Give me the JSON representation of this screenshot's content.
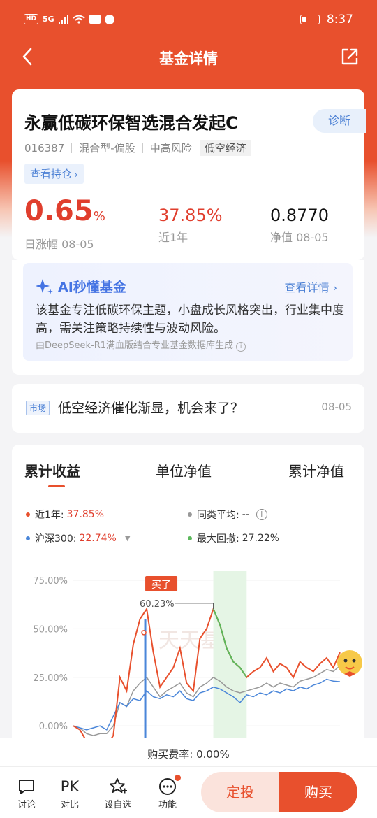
{
  "status": {
    "time": "8:37",
    "network": "5G",
    "hd": "HD"
  },
  "nav": {
    "title": "基金详情"
  },
  "fund": {
    "name": "永赢低碳环保智选混合发起C",
    "diagnose": "诊断",
    "code": "016387",
    "type": "混合型-偏股",
    "risk": "中高风险",
    "theme": "低空经济",
    "holdings_link": "查看持仓"
  },
  "metrics": {
    "daily": {
      "value": "0.65",
      "unit": "%",
      "label": "日涨幅 08-05"
    },
    "year": {
      "value": "37.85%",
      "label": "近1年"
    },
    "nav": {
      "value": "0.8770",
      "label": "净值 08-05"
    }
  },
  "ai": {
    "title": "AI秒懂基金",
    "detail": "查看详情",
    "body": "该基金专注低碳环保主题，小盘成长风格突出，行业集中度高，需关注策略持续性与波动风险。",
    "footer": "由DeepSeek-R1满血版结合专业基金数据库生成"
  },
  "market": {
    "tag": "市场",
    "text": "低空经济催化渐显，机会来了？",
    "date": "08-05"
  },
  "tabs": [
    "累计收益",
    "单位净值",
    "累计净值"
  ],
  "legend": {
    "fund_label": "近1年:",
    "fund_value": "37.85%",
    "avg_label": "同类平均:",
    "avg_value": "--",
    "index_label": "沪深300:",
    "index_value": "22.74%",
    "drawdown_label": "最大回撤:",
    "drawdown_value": "27.22%"
  },
  "chart_marks": {
    "buy": "买了",
    "peak": "60.23%",
    "watermark": "天天基金"
  },
  "colors": {
    "fund": "#e8502d",
    "index": "#4a86d9",
    "average": "#999999",
    "drawdown": "#5cb85c"
  },
  "chart_data": {
    "type": "line",
    "yticks": [
      "75.00%",
      "50.00%",
      "25.00%",
      "0.00%"
    ],
    "ylim": [
      -10,
      80
    ],
    "series": [
      {
        "name": "近1年",
        "values": [
          0,
          -2,
          -8,
          -10,
          -9,
          -10,
          -5,
          25,
          18,
          42,
          55,
          60.23,
          38,
          20,
          25,
          30,
          40,
          22,
          18,
          45,
          50,
          60.23,
          52,
          40,
          33,
          30,
          25,
          28,
          30,
          35,
          28,
          32,
          30,
          25,
          33,
          30,
          28,
          32,
          35,
          30,
          37.85
        ]
      },
      {
        "name": "沪深300",
        "values": [
          0,
          -1,
          -2,
          -1,
          0,
          -2,
          5,
          12,
          10,
          14,
          13,
          18,
          15,
          14,
          16,
          15,
          18,
          14,
          13,
          17,
          18,
          20,
          19,
          17,
          15,
          12,
          16,
          15,
          17,
          16,
          18,
          17,
          19,
          18,
          20,
          19,
          21,
          22,
          24,
          23,
          22.74
        ]
      },
      {
        "name": "同类平均",
        "values": [
          0,
          -1,
          -4,
          -5,
          -4,
          -4,
          0,
          12,
          10,
          18,
          22,
          25,
          20,
          15,
          18,
          20,
          22,
          17,
          15,
          20,
          22,
          25,
          23,
          20,
          18,
          17,
          18,
          19,
          20,
          22,
          20,
          22,
          21,
          20,
          23,
          24,
          25,
          27,
          29,
          28,
          31
        ]
      }
    ]
  },
  "bottom": {
    "fee": "购买费率: 0.00%",
    "tools": [
      "讨论",
      "对比",
      "设自选",
      "功能"
    ],
    "pk": "PK",
    "regular": "定投",
    "buy": "购买"
  }
}
